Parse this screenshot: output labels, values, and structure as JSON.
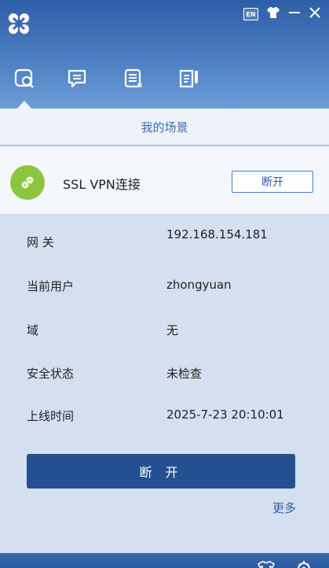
{
  "window": {
    "lang_badge": "EN"
  },
  "nav": {
    "tabs": [
      {
        "name": "connection",
        "icon": "link-icon"
      },
      {
        "name": "messages",
        "icon": "message-icon"
      },
      {
        "name": "list",
        "icon": "list-icon"
      },
      {
        "name": "notes",
        "icon": "note-icon"
      }
    ]
  },
  "scene": {
    "title": "我的场景"
  },
  "connection": {
    "label": "SSL VPN连接",
    "disconnect_label": "断开",
    "status_color": "#8cc63f"
  },
  "details": {
    "gateway_label": "网 关",
    "gateway_value": "192.168.154.181",
    "user_label": "当前用户",
    "user_value": "zhongyuan",
    "domain_label": "域",
    "domain_value": "无",
    "security_label": "安全状态",
    "security_value": "未检查",
    "online_label": "上线时间",
    "online_value": "2025-7-23 20:10:01"
  },
  "actions": {
    "disconnect_label": "断 开",
    "more_label": "更多"
  },
  "colors": {
    "header": "#2e5ea7",
    "accent": "#245093",
    "link": "#2f5fa8"
  }
}
